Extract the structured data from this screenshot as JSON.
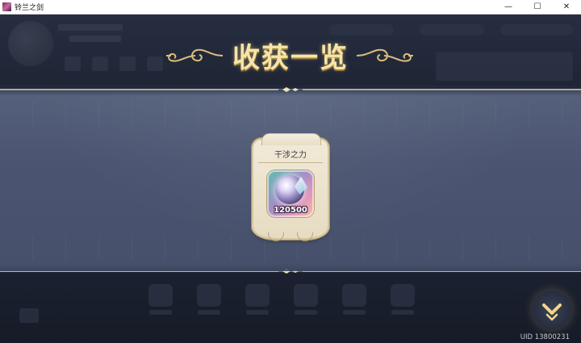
{
  "window": {
    "title": "铃兰之剑",
    "controls": {
      "minimize": "—",
      "maximize": "☐",
      "close": "✕"
    }
  },
  "overlay": {
    "title": "收获一览",
    "items": [
      {
        "name": "干涉之力",
        "count": "120500",
        "icon": "crystal-orb-icon"
      }
    ]
  },
  "footer": {
    "uid": "UID 13800231"
  },
  "colors": {
    "title_gold": "#f7e4a6",
    "panel_blue": "#4b5571",
    "card_cream": "#efe7d3",
    "accent_gold": "#e8cf8a"
  }
}
